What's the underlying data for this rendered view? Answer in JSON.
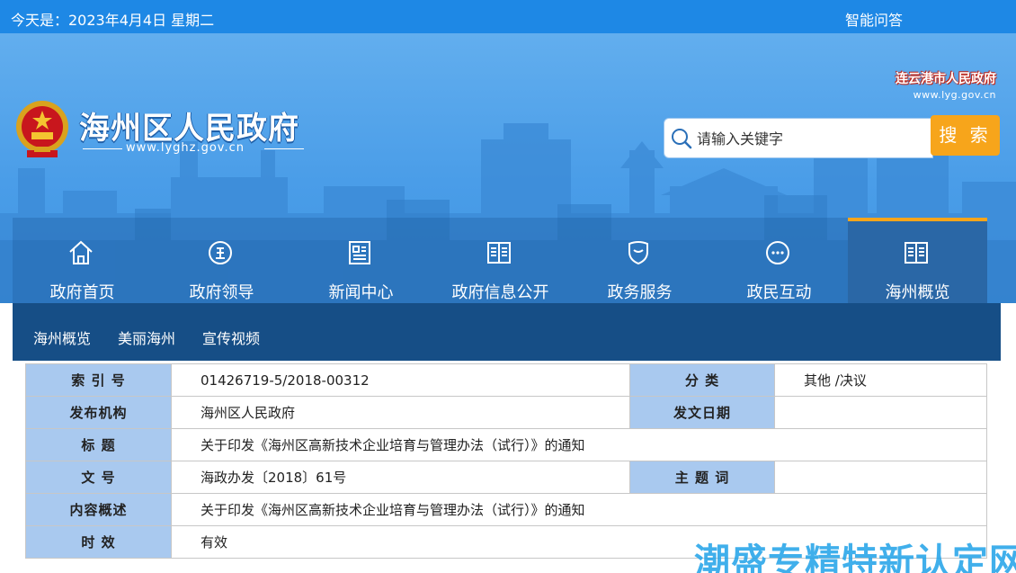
{
  "topbar": {
    "date_text": "今天是：2023年4月4日 星期二",
    "qa_link": "智能问答"
  },
  "header": {
    "site_title": "海州区人民政府",
    "site_domain": "www.lyghz.gov.cn",
    "city_link_cn": "连云港市人民政府",
    "city_link_en": "www.lyg.gov.cn"
  },
  "search": {
    "placeholder": "请输入关键字",
    "button_label": "搜 索"
  },
  "nav": {
    "items": [
      {
        "label": "政府首页",
        "icon": "home-icon"
      },
      {
        "label": "政府领导",
        "icon": "leader-icon"
      },
      {
        "label": "新闻中心",
        "icon": "news-icon"
      },
      {
        "label": "政府信息公开",
        "icon": "book-icon"
      },
      {
        "label": "政务服务",
        "icon": "shield-icon"
      },
      {
        "label": "政民互动",
        "icon": "chat-icon"
      },
      {
        "label": "海州概览",
        "icon": "book-icon",
        "active": true
      }
    ]
  },
  "subnav": {
    "items": [
      "海州概览",
      "美丽海州",
      "宣传视频"
    ]
  },
  "info": {
    "index_label": "索 引 号",
    "index_value": "01426719-5/2018-00312",
    "category_label": "分 类",
    "category_value": "其他 /决议",
    "publisher_label": "发布机构",
    "publisher_value": "海州区人民政府",
    "issue_date_label": "发文日期",
    "issue_date_value": "",
    "title_label": "标 题",
    "title_value": "关于印发《海州区高新技术企业培育与管理办法（试行）》的通知",
    "doc_no_label": "文 号",
    "doc_no_value": "海政办发〔2018〕61号",
    "subject_label": "主 题 词",
    "subject_value": "",
    "summary_label": "内容概述",
    "summary_value": "关于印发《海州区高新技术企业培育与管理办法（试行）》的通知",
    "validity_label": "时 效",
    "validity_value": "有效"
  },
  "watermark": "潮盛专精特新认定网",
  "colors": {
    "topbar": "#1e88e5",
    "banner": "#4a9de8",
    "subnav": "#164e86",
    "label_cell": "#a9c9ef",
    "search_button": "#f7a51b",
    "active_tab_border": "#f7a51b"
  }
}
